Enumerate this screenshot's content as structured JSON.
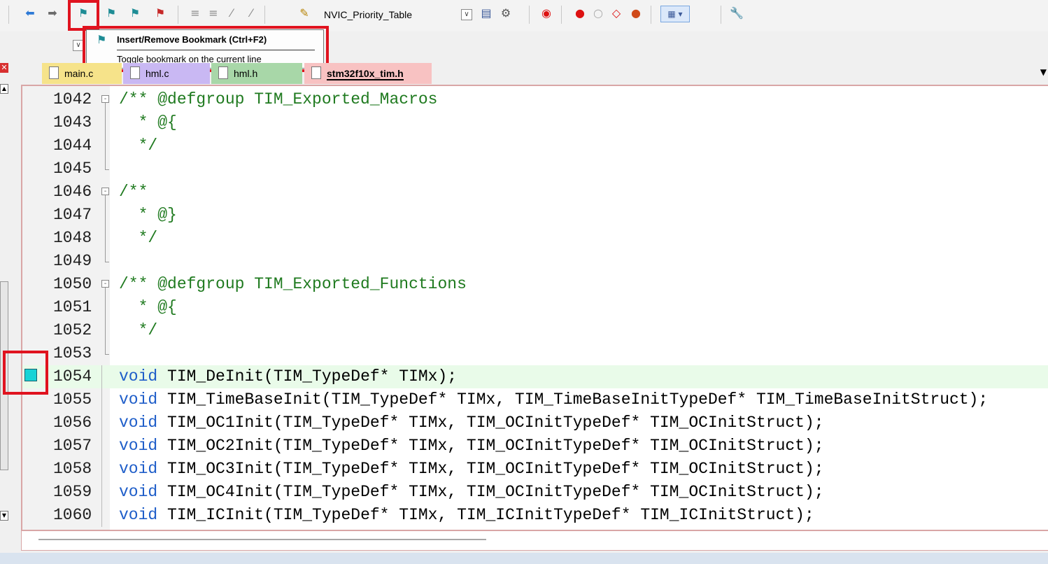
{
  "toolbar": {
    "project_combo_value": "NVIC_Priority_Table"
  },
  "tooltip": {
    "title": "Insert/Remove Bookmark (Ctrl+F2)",
    "description": "Toggle bookmark on the current line"
  },
  "tabs": [
    {
      "label": "main.c",
      "active": false,
      "color": "#f6e38a"
    },
    {
      "label": "hml.c",
      "active": false,
      "color": "#c9b8f3"
    },
    {
      "label": "hml.h",
      "active": false,
      "color": "#a8d7a8"
    },
    {
      "label": "stm32f10x_tim.h",
      "active": true,
      "color": "#f8c2c2"
    }
  ],
  "editor": {
    "lines": [
      {
        "num": "1042",
        "text": "/** @defgroup TIM_Exported_Macros",
        "kind": "comment",
        "fold": "open"
      },
      {
        "num": "1043",
        "text": "  * @{",
        "kind": "comment",
        "fold": "line"
      },
      {
        "num": "1044",
        "text": "  */",
        "kind": "comment",
        "fold": "line"
      },
      {
        "num": "1045",
        "text": "",
        "kind": "plain",
        "fold": "end"
      },
      {
        "num": "1046",
        "text": "/**",
        "kind": "comment",
        "fold": "open"
      },
      {
        "num": "1047",
        "text": "  * @}",
        "kind": "comment",
        "fold": "line"
      },
      {
        "num": "1048",
        "text": "  */",
        "kind": "comment",
        "fold": "line"
      },
      {
        "num": "1049",
        "text": "",
        "kind": "plain",
        "fold": "end"
      },
      {
        "num": "1050",
        "text": "/** @defgroup TIM_Exported_Functions",
        "kind": "comment",
        "fold": "open"
      },
      {
        "num": "1051",
        "text": "  * @{",
        "kind": "comment",
        "fold": "line"
      },
      {
        "num": "1052",
        "text": "  */",
        "kind": "comment",
        "fold": "line"
      },
      {
        "num": "1053",
        "text": "",
        "kind": "plain",
        "fold": "end"
      },
      {
        "num": "1054",
        "text": "void TIM_DeInit(TIM_TypeDef* TIMx);",
        "kind": "code",
        "fold": "none",
        "active": true,
        "bookmark": true
      },
      {
        "num": "1055",
        "text": "void TIM_TimeBaseInit(TIM_TypeDef* TIMx, TIM_TimeBaseInitTypeDef* TIM_TimeBaseInitStruct);",
        "kind": "code",
        "fold": "none"
      },
      {
        "num": "1056",
        "text": "void TIM_OC1Init(TIM_TypeDef* TIMx, TIM_OCInitTypeDef* TIM_OCInitStruct);",
        "kind": "code",
        "fold": "none"
      },
      {
        "num": "1057",
        "text": "void TIM_OC2Init(TIM_TypeDef* TIMx, TIM_OCInitTypeDef* TIM_OCInitStruct);",
        "kind": "code",
        "fold": "none"
      },
      {
        "num": "1058",
        "text": "void TIM_OC3Init(TIM_TypeDef* TIMx, TIM_OCInitTypeDef* TIM_OCInitStruct);",
        "kind": "code",
        "fold": "none"
      },
      {
        "num": "1059",
        "text": "void TIM_OC4Init(TIM_TypeDef* TIMx, TIM_OCInitTypeDef* TIM_OCInitStruct);",
        "kind": "code",
        "fold": "none"
      },
      {
        "num": "1060",
        "text": "void TIM_ICInit(TIM_TypeDef* TIMx, TIM_ICInitTypeDef* TIM_ICInitStruct);",
        "kind": "code",
        "fold": "none"
      }
    ]
  },
  "colors": {
    "highlight_red": "#e0131f",
    "bookmark": "#17d3d6",
    "comment": "#1f7a1f",
    "keyword": "#1f5ec9",
    "active_line": "#e9fbe9"
  }
}
